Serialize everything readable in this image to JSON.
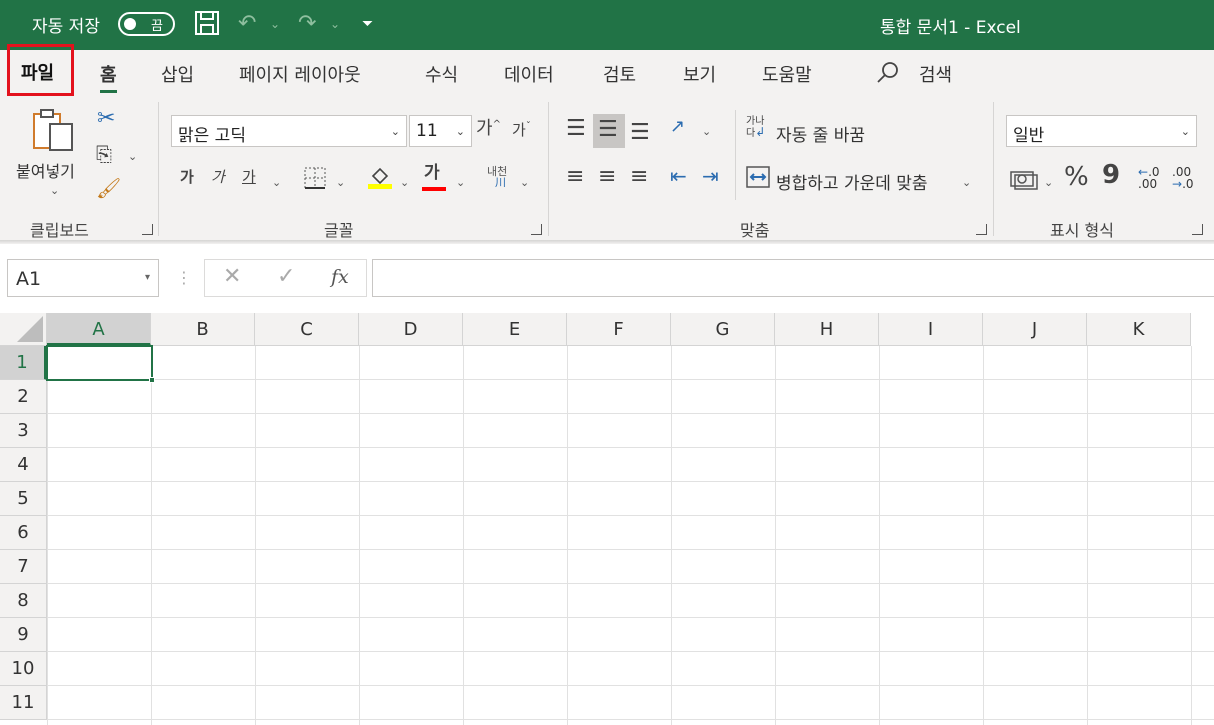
{
  "titlebar": {
    "autosave_label": "자동 저장",
    "autosave_state": "끔",
    "document_title": "통합 문서1  -  Excel"
  },
  "tabs": {
    "file": "파일",
    "home": "홈",
    "insert": "삽입",
    "page_layout": "페이지 레이아웃",
    "formulas": "수식",
    "data": "데이터",
    "review": "검토",
    "view": "보기",
    "help": "도움말",
    "search": "검색"
  },
  "ribbon": {
    "clipboard": {
      "label": "클립보드",
      "paste": "붙여넣기"
    },
    "font": {
      "label": "글꼴",
      "font_name": "맑은 고딕",
      "font_size": "11",
      "grow": "가",
      "shrink": "가",
      "bold": "가",
      "italic": "가",
      "underline": "가",
      "font_color": "가",
      "phonetic_top": "내천",
      "phonetic_bottom": "川"
    },
    "alignment": {
      "label": "맞춤",
      "wrap_text": "자동 줄 바꿈",
      "merge_center": "병합하고 가운데 맞춤",
      "wrap_icon_top": "가나",
      "wrap_icon_bottom": "다"
    },
    "number": {
      "label": "표시 형식",
      "format": "일반",
      "percent": "%",
      "comma": "9",
      "inc_decimal_a": ".0",
      "inc_decimal_b": ".00",
      "dec_decimal_a": ".00",
      "dec_decimal_b": ".0"
    }
  },
  "formula_bar": {
    "name_box": "A1",
    "fx": "fx",
    "value": ""
  },
  "sheet": {
    "columns": [
      "A",
      "B",
      "C",
      "D",
      "E",
      "F",
      "G",
      "H",
      "I",
      "J",
      "K"
    ],
    "rows": [
      "1",
      "2",
      "3",
      "4",
      "5",
      "6",
      "7",
      "8",
      "9",
      "10",
      "11"
    ],
    "active_cell": "A1"
  },
  "colors": {
    "brand": "#217346",
    "highlight_red": "#e3121d",
    "fill_yellow": "#ffff00",
    "font_red": "#ff0000"
  }
}
